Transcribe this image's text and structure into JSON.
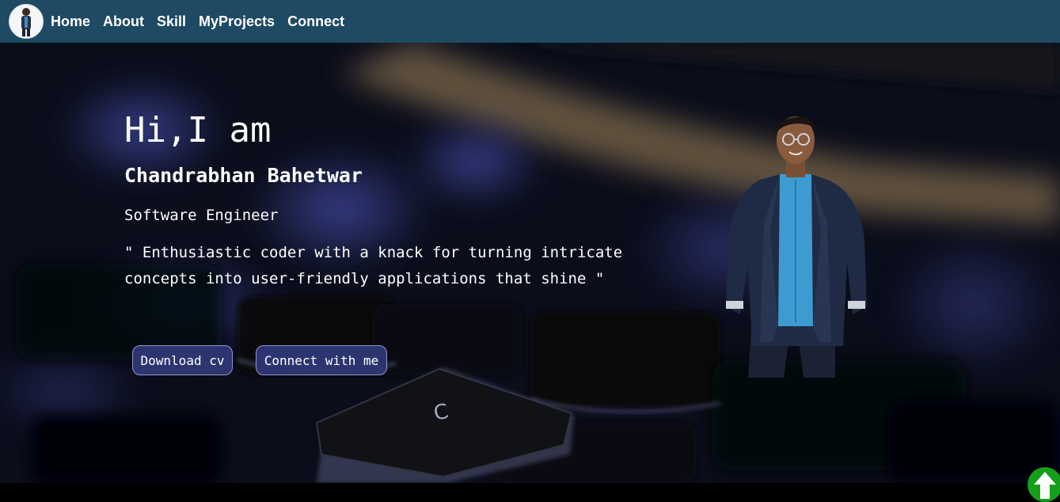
{
  "nav": {
    "avatar_alt": "profile photo",
    "links": [
      {
        "label": "Home"
      },
      {
        "label": "About"
      },
      {
        "label": "Skill"
      },
      {
        "label": "MyProjects"
      },
      {
        "label": "Connect"
      }
    ]
  },
  "hero": {
    "greeting": "Hi,I am",
    "name": "Chandrabhan Bahetwar",
    "role": "Software Engineer",
    "tagline": "\" Enthusiastic coder with a knack for turning intricate concepts into user-friendly applications that shine \"",
    "buttons": {
      "download_cv": "Download cv",
      "connect": "Connect with me"
    },
    "background_keycap": "C"
  },
  "scroll_top": {
    "icon": "arrow-up-icon"
  },
  "colors": {
    "navbar": "#1e4a63",
    "button_bg": "#2d3570",
    "scroll_top": "#14a01a"
  }
}
